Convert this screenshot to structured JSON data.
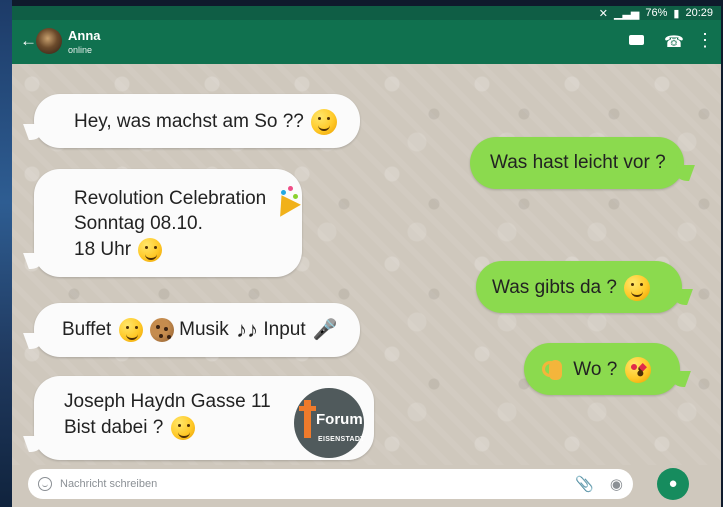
{
  "status_bar": {
    "battery": "76%",
    "time": "20:29"
  },
  "header": {
    "name": "Anna",
    "status": "online"
  },
  "chat": {
    "messages": [
      {
        "text_before_emoji": "Hey, was machst am So ?? "
      },
      {
        "text": "Was hast leicht vor ?"
      },
      {
        "line1": "Revolution Celebration ",
        "line2": "Sonntag 08.10.",
        "line3": "18 Uhr "
      },
      {
        "text_before_emoji": "Was gibts da ? "
      },
      {
        "segments": [
          "Buffet ",
          " Musik",
          " Input "
        ]
      },
      {
        "text": " Wo ? "
      },
      {
        "line1": "Joseph Haydn Gasse 11",
        "line2": "Bist dabei ? "
      }
    ],
    "logo": {
      "title": "Forum",
      "subtitle": "EISENSTADT"
    }
  },
  "composer": {
    "placeholder": "Nachricht schreiben"
  },
  "icons": {
    "back": "back-arrow-icon",
    "video": "video-call-icon",
    "phone": "phone-icon",
    "menu": "more-vert-icon",
    "attach": "paperclip-icon",
    "camera": "camera-icon",
    "mic": "microphone-icon"
  },
  "colors": {
    "header": "#10714f",
    "status_bar": "#0f5e45",
    "outgoing": "#8bda4e",
    "incoming": "#fbfbfb"
  }
}
